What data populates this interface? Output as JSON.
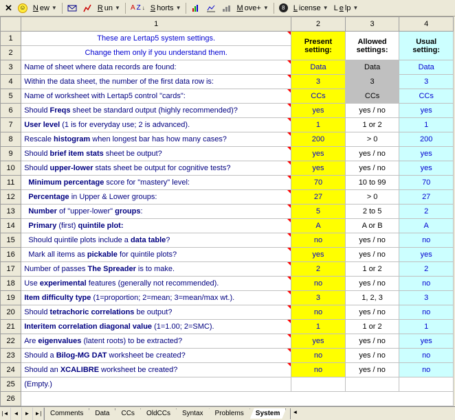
{
  "toolbar": {
    "new": "New",
    "run": "Run",
    "shorts": "Shorts",
    "move": "Move+",
    "license": "License",
    "help": "Lelp"
  },
  "colhdrs": {
    "c1": "1",
    "c2": "2",
    "c3": "3",
    "c4": "4"
  },
  "header": {
    "line1": "These are Lertap5 system settings.",
    "line2": "Change them only if you understand them.",
    "present": "Present setting:",
    "allowed": "Allowed settings:",
    "usual": "Usual setting:"
  },
  "rows": [
    {
      "n": "3",
      "d": "Name of sheet where data records are found:",
      "p": "Data",
      "a": "Data",
      "u": "Data",
      "ag": true
    },
    {
      "n": "4",
      "d": "Within the data sheet, the number of the first data row is:",
      "p": "3",
      "a": "3",
      "u": "3",
      "ag": true
    },
    {
      "n": "5",
      "d": "Name of worksheet with Lertap5 control \"cards\":",
      "p": "CCs",
      "a": "CCs",
      "u": "CCs",
      "ag": true
    },
    {
      "n": "6",
      "dh": "Should <b>Freqs</b> sheet be standard output (highly recommended)?",
      "p": "yes",
      "a": "yes / no",
      "u": "yes"
    },
    {
      "n": "7",
      "dh": "<b>User level</b> (1 is for everyday use; 2 is advanced).",
      "p": "1",
      "a": "1 or 2",
      "u": "1"
    },
    {
      "n": "8",
      "dh": "Rescale <b>histogram</b> when longest bar has how many cases?",
      "p": "200",
      "a": "> 0",
      "u": "200"
    },
    {
      "n": "9",
      "dh": "Should <b>brief item stats</b> sheet be output?",
      "p": "yes",
      "a": "yes / no",
      "u": "yes"
    },
    {
      "n": "10",
      "dh": "Should <b>upper-lower</b> stats sheet be output for cognitive tests?",
      "p": "yes",
      "a": "yes / no",
      "u": "yes"
    },
    {
      "n": "11",
      "dh": "&nbsp;&nbsp;<b>Minimum percentage</b> score for \"mastery\" level:",
      "p": "70",
      "a": "10 to 99",
      "u": "70"
    },
    {
      "n": "12",
      "dh": "&nbsp;&nbsp;<b>Percentage</b> in Upper & Lower groups:",
      "p": "27",
      "a": "> 0",
      "u": "27"
    },
    {
      "n": "13",
      "dh": "&nbsp;&nbsp;<b>Number</b> of \"upper-lower\" <b>groups</b>:",
      "p": "5",
      "a": "2 to 5",
      "u": "2"
    },
    {
      "n": "14",
      "dh": "&nbsp;&nbsp;<b>Primary</b> (first) <b>quintile plot:</b>",
      "p": "A",
      "a": "A or B",
      "u": "A"
    },
    {
      "n": "15",
      "dh": "&nbsp;&nbsp;Should quintile plots include a <b>data table</b>?",
      "p": "no",
      "a": "yes / no",
      "u": "no"
    },
    {
      "n": "16",
      "dh": "&nbsp;&nbsp;Mark all items as <b>pickable</b> for quintile plots?",
      "p": "yes",
      "a": "yes / no",
      "u": "yes",
      "dash": true
    },
    {
      "n": "17",
      "dh": "Number of passes <b>The Spreader</b> is to make.",
      "p": "2",
      "a": "1 or 2",
      "u": "2"
    },
    {
      "n": "18",
      "dh": "Use <b>experimental</b> features (generally not recommended).",
      "p": "no",
      "a": "yes / no",
      "u": "no"
    },
    {
      "n": "19",
      "dh": "<b>Item difficulty type</b> (1=proportion; 2=mean; 3=mean/max wt.).",
      "p": "3",
      "a": "1, 2, 3",
      "u": "3"
    },
    {
      "n": "20",
      "dh": "Should <b>tetrachoric correlations</b> be output?",
      "p": "no",
      "a": "yes / no",
      "u": "no"
    },
    {
      "n": "21",
      "dh": "<b>Interitem correlation diagonal value</b> (1=1.00; 2=SMC).",
      "p": "1",
      "a": "1 or 2",
      "u": "1"
    },
    {
      "n": "22",
      "dh": "Are <b>eigenvalues</b> (latent roots) to be extracted?",
      "p": "yes",
      "a": "yes / no",
      "u": "yes",
      "dash": true
    },
    {
      "n": "23",
      "dh": "Should a <b>Bilog-MG DAT</b> worksheet be created?",
      "p": "no",
      "a": "yes / no",
      "u": "no",
      "dash": true
    },
    {
      "n": "24",
      "dh": "Should an <b>XCALIBRE</b> worksheet be created?",
      "p": "no",
      "a": "yes / no",
      "u": "no"
    },
    {
      "n": "25",
      "d": "(Empty.)",
      "p": "",
      "a": "",
      "u": "",
      "empty": true
    }
  ],
  "tabs": [
    "Comments",
    "Data",
    "CCs",
    "OldCCs",
    "Syntax",
    "Problems",
    "System"
  ],
  "activeTab": "System"
}
